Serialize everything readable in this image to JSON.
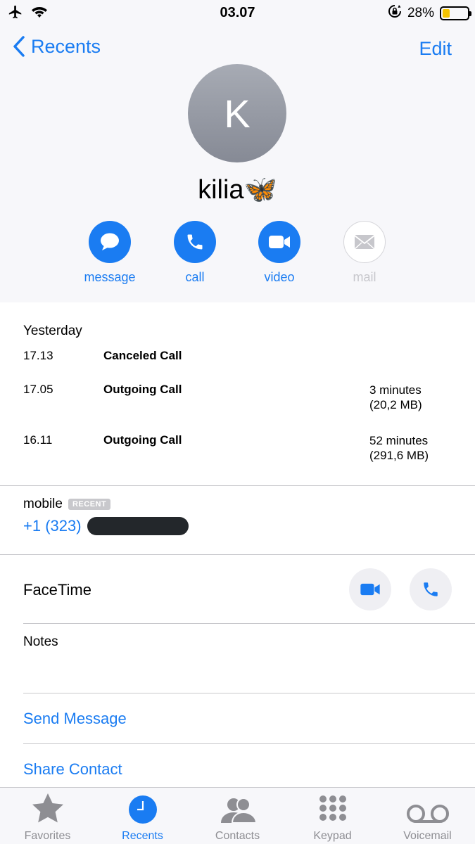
{
  "status_bar": {
    "time": "03.07",
    "battery_percent": "28%",
    "battery_level": 0.28,
    "battery_color": "#f4c400",
    "icons": [
      "airplane-icon",
      "wifi-icon",
      "orientation-lock-icon",
      "battery-icon"
    ]
  },
  "nav": {
    "back_label": "Recents",
    "edit_label": "Edit"
  },
  "contact": {
    "initial": "K",
    "name": "kilia🦋"
  },
  "actions": {
    "message": "message",
    "call": "call",
    "video": "video",
    "mail": "mail"
  },
  "history": {
    "day": "Yesterday",
    "calls": [
      {
        "time": "17.13",
        "kind": "Canceled Call",
        "duration": "",
        "size": ""
      },
      {
        "time": "17.05",
        "kind": "Outgoing Call",
        "duration": "3 minutes",
        "size": "(20,2 MB)"
      },
      {
        "time": "16.11",
        "kind": "Outgoing Call",
        "duration": "52 minutes",
        "size": "(291,6 MB)"
      }
    ]
  },
  "phone": {
    "label": "mobile",
    "badge": "RECENT",
    "number_prefix": "+1 (323)"
  },
  "facetime": {
    "label": "FaceTime"
  },
  "notes": {
    "label": "Notes"
  },
  "links": {
    "send_message": "Send Message",
    "share_contact": "Share Contact"
  },
  "tabbar": {
    "tabs": [
      {
        "label": "Favorites",
        "icon": "star-icon"
      },
      {
        "label": "Recents",
        "icon": "clock-icon",
        "active": true
      },
      {
        "label": "Contacts",
        "icon": "contacts-icon"
      },
      {
        "label": "Keypad",
        "icon": "keypad-icon"
      },
      {
        "label": "Voicemail",
        "icon": "voicemail-icon"
      }
    ]
  },
  "colors": {
    "accent": "#1a7cf2",
    "inactive": "#8e8e93",
    "separator": "#c8c8cc",
    "header_bg": "#f7f7fa"
  }
}
